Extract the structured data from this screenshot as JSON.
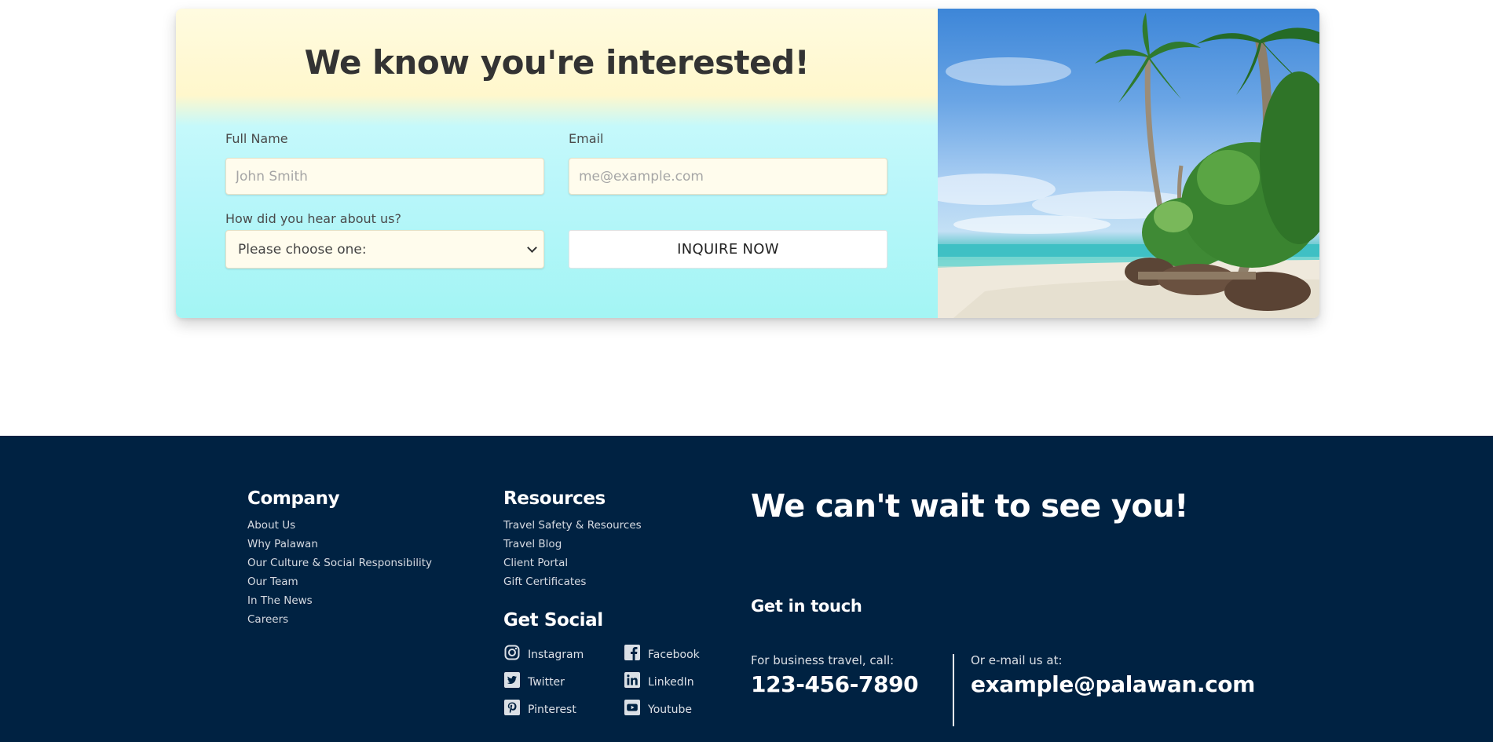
{
  "inquiry": {
    "title": "We know you're interested!",
    "full_name_label": "Full Name",
    "full_name_placeholder": "John Smith",
    "email_label": "Email",
    "email_placeholder": "me@example.com",
    "source_label": "How did you hear about us?",
    "source_selected": "Please choose one:",
    "submit_label": "INQUIRE NOW"
  },
  "footer": {
    "company_heading": "Company",
    "company_links": [
      "About Us",
      "Why Palawan",
      "Our Culture & Social Responsibility",
      "Our Team",
      "In The News",
      "Careers"
    ],
    "resources_heading": "Resources",
    "resources_links": [
      "Travel Safety & Resources",
      "Travel Blog",
      "Client Portal",
      "Gift Certificates"
    ],
    "social_heading": "Get Social",
    "social": [
      {
        "label": "Instagram",
        "icon": "instagram-icon"
      },
      {
        "label": "Facebook",
        "icon": "facebook-icon"
      },
      {
        "label": "Twitter",
        "icon": "twitter-icon"
      },
      {
        "label": "LinkedIn",
        "icon": "linkedin-icon"
      },
      {
        "label": "Pinterest",
        "icon": "pinterest-icon"
      },
      {
        "label": "Youtube",
        "icon": "youtube-icon"
      }
    ],
    "tagline": "We can't wait to see you!",
    "touch_heading": "Get in touch",
    "phone_label": "For business travel, call:",
    "phone": "123-456-7890",
    "email_label": "Or e-mail us at:",
    "email": "example@palawan.com"
  },
  "colors": {
    "footer_bg": "#002242",
    "title_text": "#333333"
  }
}
